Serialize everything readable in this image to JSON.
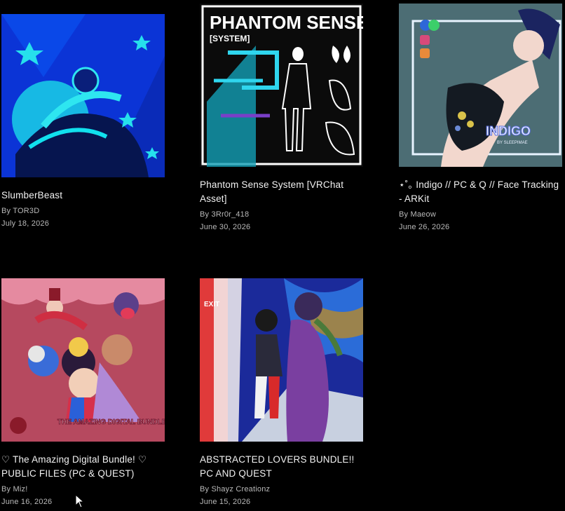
{
  "author_prefix": "By ",
  "products": [
    {
      "title": "SlumberBeast",
      "author": "TOR3D",
      "date": "July 18, 2026",
      "thumb_colors": [
        "#0a3fd8",
        "#19d6e6"
      ],
      "thumb_icon": "blue-neon-sleeping-character"
    },
    {
      "title": "Phantom Sense System [VRChat Asset]",
      "author": "3Rr0r_418",
      "date": "June 30, 2026",
      "thumb_colors": [
        "#0b0b0b",
        "#2fd6ee"
      ],
      "thumb_icon": "phantom-sense-body-diagram",
      "thumb_heading": "PHANTOM SENSE",
      "thumb_subheading": "[SYSTEM]"
    },
    {
      "title": "⋆˚｡ Indigo // PC & Q // Face Tracking - ARKit",
      "author": "Maeow",
      "date": "June 26, 2026",
      "thumb_colors": [
        "#5a7f86",
        "#1a2550"
      ],
      "thumb_icon": "indigo-avatar-photo",
      "thumb_heading": "INDIGO",
      "thumb_subheading": "BY SLEEPIMAE"
    },
    {
      "title": "♡ The Amazing Digital Bundle! ♡ PUBLIC FILES (PC & QUEST)",
      "author": "Miz!",
      "date": "June 16, 2026",
      "thumb_colors": [
        "#b84a63",
        "#f4a9b8"
      ],
      "thumb_icon": "amazing-digital-circus-group",
      "thumb_heading": "THE AMAZING DIGITAL BUNDLE"
    },
    {
      "title": "ABSTRACTED LOVERS BUNDLE!! PC AND QUEST",
      "author": "Shayz Creationz",
      "date": "June 15, 2026",
      "thumb_colors": [
        "#1b2fa0",
        "#8a3fb0"
      ],
      "thumb_icon": "abstracted-lovers-dancers",
      "thumb_sign": "EXIT"
    }
  ]
}
